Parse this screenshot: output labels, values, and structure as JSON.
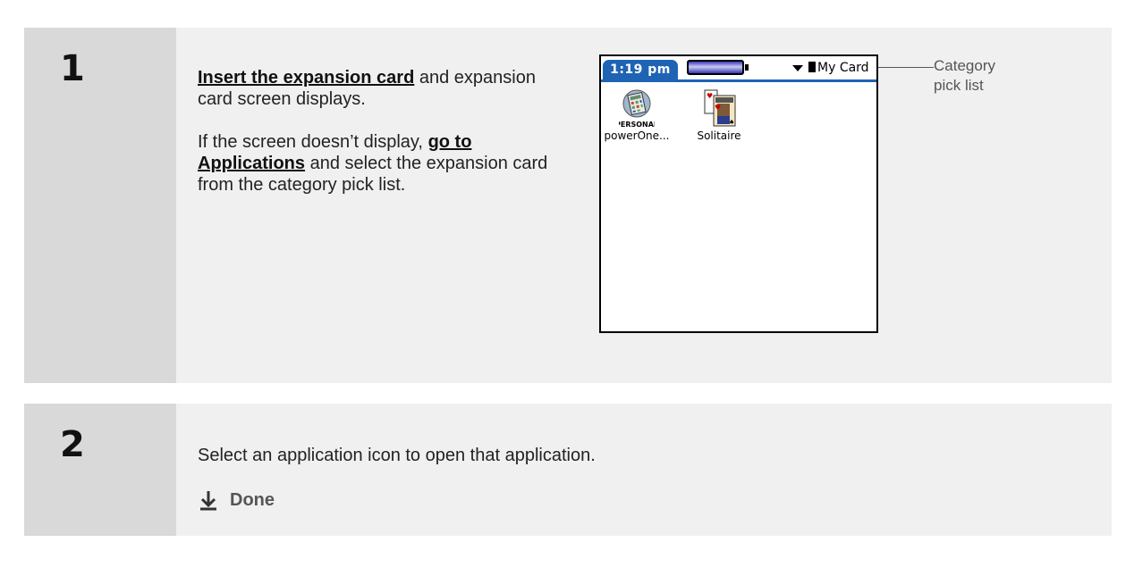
{
  "step1": {
    "number": "1",
    "insert_link": "Insert the expansion card",
    "text_after_insert": " and expansion card screen displays.",
    "text_before_go": "If the screen doesn’t display, ",
    "go_link": "go to Applications",
    "text_after_go": " and select the expansion card from the category pick list."
  },
  "palm_screen": {
    "time": "1:19 pm",
    "category": "My Card",
    "apps": [
      {
        "name": "powerOne...",
        "badge": "PERSONAL",
        "icon": "calculator-icon"
      },
      {
        "name": "Solitaire",
        "icon": "playing-cards-icon"
      }
    ]
  },
  "callout": {
    "line1": "Category",
    "line2": "pick list"
  },
  "step2": {
    "number": "2",
    "instruction": "Select an application icon to open that application.",
    "done_label": "Done",
    "done_icon": "down-arrow-icon"
  },
  "colors": {
    "palm_blue": "#1f64b4",
    "step_gray": "#d9d9d9",
    "content_bg": "#f0f0f0"
  }
}
